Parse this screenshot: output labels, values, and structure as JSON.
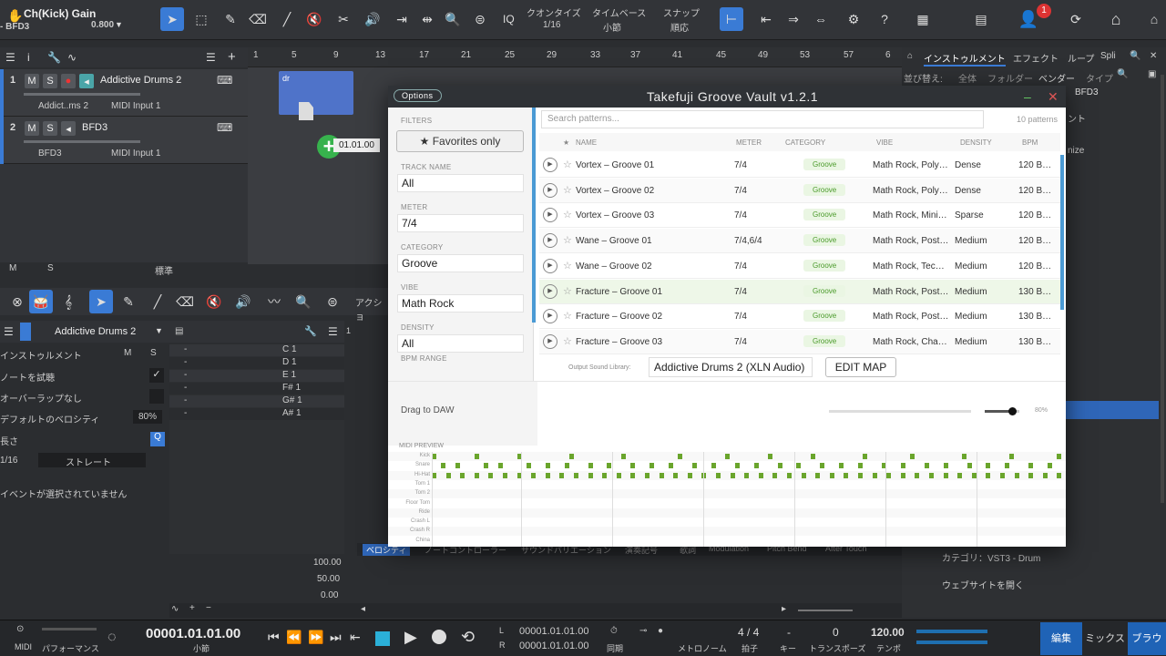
{
  "toolbar": {
    "title": "Ch(Kick) Gain",
    "sub": "- BFD3",
    "gain_value": "0.800",
    "iq": "IQ",
    "quantize_label": "クオンタイズ",
    "quantize_value": "1/16",
    "timebase_label": "タイムベース",
    "timebase_value": "小節",
    "snap_label": "スナップ",
    "snap_value": "順応",
    "notif_count": "1"
  },
  "tracks": [
    {
      "num": "1",
      "name": "Addictive Drums 2",
      "inst": "Addict..ms 2",
      "input": "MIDI Input 1"
    },
    {
      "num": "2",
      "name": "BFD3",
      "inst": "BFD3",
      "input": "MIDI Input 1"
    }
  ],
  "ruler": [
    "1",
    "5",
    "9",
    "13",
    "17",
    "21",
    "25",
    "29",
    "33",
    "37",
    "41",
    "45",
    "49",
    "53",
    "57",
    "6"
  ],
  "clip": {
    "label": "dr",
    "drag_pos": "01.01.00"
  },
  "track_footer": {
    "m": "M",
    "s": "S",
    "mode": "標準"
  },
  "plugin": {
    "options": "Options",
    "title": "Takefuji Groove Vault  v1.2.1",
    "search_placeholder": "Search patterns...",
    "count": "10 patterns",
    "filters": "FILTERS",
    "favorites": "Favorites only",
    "filter_items": [
      {
        "label": "TRACK NAME",
        "value": "All"
      },
      {
        "label": "METER",
        "value": "7/4"
      },
      {
        "label": "CATEGORY",
        "value": "Groove"
      },
      {
        "label": "VIBE",
        "value": "Math Rock"
      },
      {
        "label": "DENSITY",
        "value": "All"
      }
    ],
    "bpm_range": "BPM RANGE",
    "cols": {
      "name": "NAME",
      "meter": "METER",
      "category": "CATEGORY",
      "vibe": "VIBE",
      "density": "DENSITY",
      "bpm": "BPM"
    },
    "rows": [
      {
        "name": "Vortex – Groove 01",
        "meter": "7/4",
        "category": "Groove",
        "vibe": "Math Rock, Poly…",
        "density": "Dense",
        "bpm": "120 B…"
      },
      {
        "name": "Vortex – Groove 02",
        "meter": "7/4",
        "category": "Groove",
        "vibe": "Math Rock, Poly…",
        "density": "Dense",
        "bpm": "120 B…"
      },
      {
        "name": "Vortex – Groove 03",
        "meter": "7/4",
        "category": "Groove",
        "vibe": "Math Rock, Mini…",
        "density": "Sparse",
        "bpm": "120 B…"
      },
      {
        "name": "Wane – Groove 01",
        "meter": "7/4,6/4",
        "category": "Groove",
        "vibe": "Math Rock, Post…",
        "density": "Medium",
        "bpm": "120 B…"
      },
      {
        "name": "Wane – Groove 02",
        "meter": "7/4",
        "category": "Groove",
        "vibe": "Math Rock, Tec…",
        "density": "Medium",
        "bpm": "120 B…"
      },
      {
        "name": "Fracture – Groove 01",
        "meter": "7/4",
        "category": "Groove",
        "vibe": "Math Rock, Post…",
        "density": "Medium",
        "bpm": "130 B…"
      },
      {
        "name": "Fracture – Groove 02",
        "meter": "7/4",
        "category": "Groove",
        "vibe": "Math Rock, Post…",
        "density": "Medium",
        "bpm": "130 B…"
      },
      {
        "name": "Fracture – Groove 03",
        "meter": "7/4",
        "category": "Groove",
        "vibe": "Math Rock, Cha…",
        "density": "Medium",
        "bpm": "130 B…"
      }
    ],
    "output_label": "Output Sound Library:",
    "output_value": "Addictive Drums 2 (XLN Audio)",
    "edit_map": "EDIT MAP",
    "drag": "Drag to DAW",
    "volume_pct": "80%",
    "volume_level": 0.8,
    "midi_preview": "MIDI PREVIEW",
    "midi_rows": [
      "Kick",
      "Snare",
      "Hi-Hat",
      "Tom 1",
      "Tom 2",
      "Floor Tom",
      "Ride",
      "Crash L",
      "Crash R",
      "China"
    ]
  },
  "editor": {
    "track": "Addictive Drums 2",
    "action": "アクショ",
    "inspector": [
      {
        "label": "インストゥルメント"
      },
      {
        "label": "ノートを試聴"
      },
      {
        "label": "オーバーラップなし"
      },
      {
        "label": "デフォルトのベロシティ",
        "value": "80%"
      },
      {
        "label": "長さ"
      }
    ],
    "length_value": "1/16",
    "length_mode": "ストレート",
    "no_event": "イベントが選択されていません",
    "notes": [
      "C 1",
      "D 1",
      "E 1",
      "F# 1",
      "G# 1",
      "A# 1"
    ],
    "vel_scale": [
      "100.00",
      "50.00",
      "0.00"
    ],
    "lanes": [
      "ベロシティ",
      "ノートコントローラー",
      "サウンドバリエーション",
      "演奏記号",
      "歌詞",
      "Modulation",
      "Pitch Bend",
      "After Touch"
    ]
  },
  "browser": {
    "tabs": [
      "インストゥルメント",
      "エフェクト",
      "ループ",
      "Spli"
    ],
    "sort_label": "並び替え:",
    "sort_opts": [
      "全体",
      "フォルダー",
      "ベンダー",
      "タイプ"
    ],
    "selected": "BFD3",
    "frag1": "ント",
    "frag2": "nize",
    "category": "カテゴリ：VST3 - Drum",
    "website": "ウェブサイトを開く"
  },
  "transport": {
    "midi": "MIDI",
    "perf": "パフォーマンス",
    "pos": "00001.01.01.00",
    "pos_unit": "小節",
    "l_label": "L",
    "r_label": "R",
    "l_pos": "00001.01.01.00",
    "r_pos": "00001.01.01.00",
    "sync": "同期",
    "metronome": "メトロノーム",
    "sig": "4 / 4",
    "sig_label": "拍子",
    "key": "-",
    "key_label": "キー",
    "transpose": "0",
    "transpose_label": "トランスポーズ",
    "tempo": "120.00",
    "tempo_label": "テンポ",
    "edit": "編集",
    "mix": "ミックス",
    "browse": "ブラウ"
  }
}
